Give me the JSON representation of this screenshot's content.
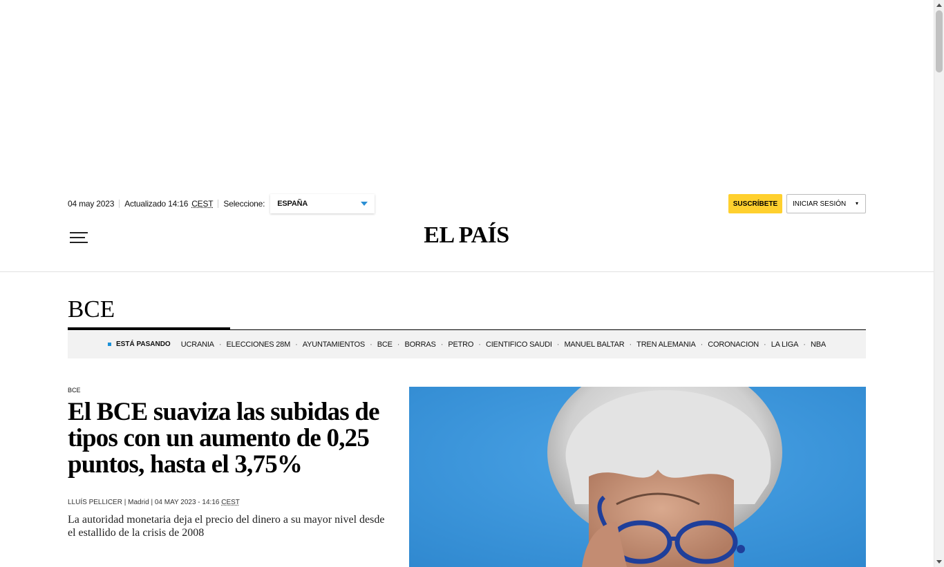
{
  "topbar": {
    "date": "04 may 2023",
    "updated_label": "Actualizado 14:16",
    "timezone": "CEST",
    "select_label": "Seleccione:",
    "edition_value": "ESPAÑA",
    "subscribe_label": "SUSCRÍBETE",
    "login_label": "INICIAR SESIÓN",
    "login_caret": "▾"
  },
  "header": {
    "logo": "EL PAÍS"
  },
  "section": {
    "title": "BCE"
  },
  "trending": {
    "label": "ESTÁ PASANDO",
    "items": [
      "UCRANIA",
      "ELECCIONES 28M",
      "AYUNTAMIENTOS",
      "BCE",
      "BORRAS",
      "PETRO",
      "CIENTIFICO SAUDI",
      "MANUEL BALTAR",
      "TREN ALEMANIA",
      "CORONACION",
      "LA LIGA",
      "NBA"
    ],
    "separator": "·"
  },
  "article": {
    "kicker": "BCE",
    "headline": "El BCE suaviza las subidas de tipos con un aumento de 0,25 puntos, hasta el 3,75%",
    "byline": {
      "author": "LLUÍS PELLICER",
      "location": "Madrid",
      "datetime": "04 MAY 2023 - 14:16",
      "timezone": "CEST"
    },
    "summary": "La autoridad monetaria deja el precio del dinero a su mayor nivel desde el estallido de la crisis de 2008"
  },
  "colors": {
    "accent_blue": "#1a91d8",
    "subscribe_yellow": "#ffd02e",
    "photo_bg": "#3a97dd"
  }
}
